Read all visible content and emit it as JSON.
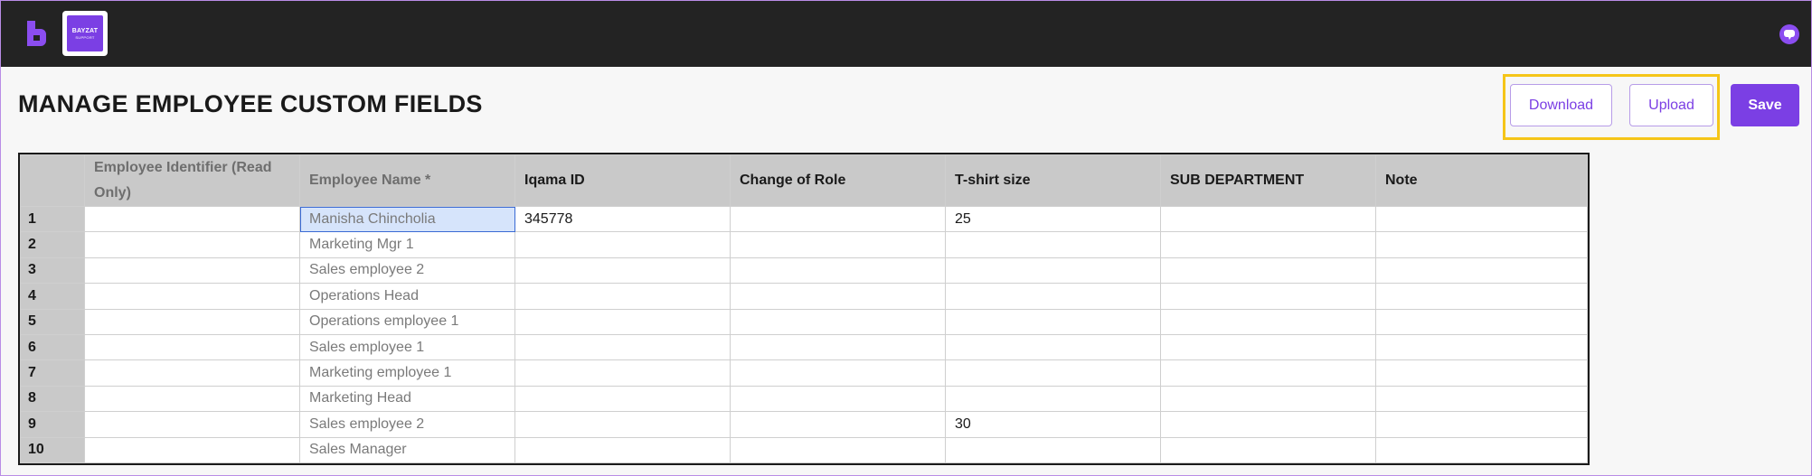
{
  "app": {
    "logo_text_line1": "BAYZAT",
    "logo_text_line2": "SUPPORT",
    "brand_color": "#7b3fe4"
  },
  "header": {
    "title": "MANAGE EMPLOYEE CUSTOM FIELDS",
    "download_label": "Download",
    "upload_label": "Upload",
    "save_label": "Save"
  },
  "table": {
    "columns": [
      "Employee Identifier (Read Only)",
      "Employee Name *",
      "Iqama ID",
      "Change of Role",
      "T-shirt size",
      "SUB DEPARTMENT",
      "Note"
    ],
    "rows": [
      {
        "num": "1",
        "identifier": "",
        "name": "Manisha Chincholia",
        "iqama": "345778",
        "role": "",
        "tshirt": "25",
        "subdept": "",
        "note": ""
      },
      {
        "num": "2",
        "identifier": "",
        "name": "Marketing Mgr 1",
        "iqama": "",
        "role": "",
        "tshirt": "",
        "subdept": "",
        "note": ""
      },
      {
        "num": "3",
        "identifier": "",
        "name": "Sales employee 2",
        "iqama": "",
        "role": "",
        "tshirt": "",
        "subdept": "",
        "note": ""
      },
      {
        "num": "4",
        "identifier": "",
        "name": "Operations Head",
        "iqama": "",
        "role": "",
        "tshirt": "",
        "subdept": "",
        "note": ""
      },
      {
        "num": "5",
        "identifier": "",
        "name": "Operations employee 1",
        "iqama": "",
        "role": "",
        "tshirt": "",
        "subdept": "",
        "note": ""
      },
      {
        "num": "6",
        "identifier": "",
        "name": "Sales employee 1",
        "iqama": "",
        "role": "",
        "tshirt": "",
        "subdept": "",
        "note": ""
      },
      {
        "num": "7",
        "identifier": "",
        "name": "Marketing employee 1",
        "iqama": "",
        "role": "",
        "tshirt": "",
        "subdept": "",
        "note": ""
      },
      {
        "num": "8",
        "identifier": "",
        "name": "Marketing Head",
        "iqama": "",
        "role": "",
        "tshirt": "",
        "subdept": "",
        "note": ""
      },
      {
        "num": "9",
        "identifier": "",
        "name": "Sales employee 2",
        "iqama": "",
        "role": "",
        "tshirt": "30",
        "subdept": "",
        "note": ""
      },
      {
        "num": "10",
        "identifier": "",
        "name": "Sales Manager",
        "iqama": "",
        "role": "",
        "tshirt": "",
        "subdept": "",
        "note": ""
      }
    ]
  }
}
